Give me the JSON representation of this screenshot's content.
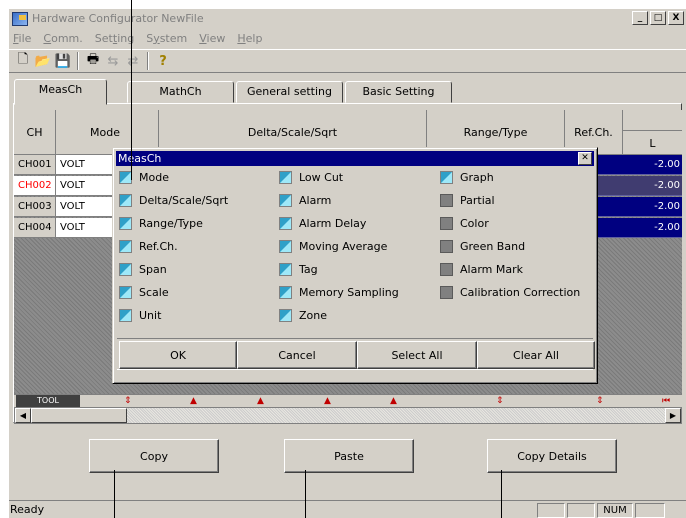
{
  "window": {
    "title": "Hardware Configurator NewFile"
  },
  "menu": [
    {
      "label": "File",
      "accel": "F",
      "rest": "ile",
      "dark": false
    },
    {
      "label": "Comm.",
      "accel": "C",
      "rest": "omm.",
      "dark": false
    },
    {
      "label": "Setting",
      "accel": "",
      "rest": "Setting",
      "dark": false
    },
    {
      "label": "System",
      "accel": "S",
      "rest": "ystem",
      "dark": false
    },
    {
      "label": "View",
      "accel": "V",
      "rest": "iew",
      "dark": false
    },
    {
      "label": "Help",
      "accel": "H",
      "rest": "elp",
      "dark": false
    }
  ],
  "tabs": [
    "MeasCh",
    "MathCh",
    "General setting",
    "Basic Setting"
  ],
  "grid": {
    "headers": [
      "CH",
      "Mode",
      "Delta/Scale/Sqrt",
      "Range/Type",
      "Ref.Ch.",
      "L"
    ],
    "rows": [
      {
        "ch": "CH001",
        "mode": "VOLT",
        "value": "-2.00",
        "red": false
      },
      {
        "ch": "CH002",
        "mode": "VOLT",
        "value": "-2.00",
        "red": true
      },
      {
        "ch": "CH003",
        "mode": "VOLT",
        "value": "-2.00",
        "red": false
      },
      {
        "ch": "CH004",
        "mode": "VOLT",
        "value": "-2.00",
        "red": false
      }
    ],
    "tool_label": "TOOL"
  },
  "dialog": {
    "title": "MeasCh",
    "close": "✕",
    "col1": [
      {
        "label": "Mode",
        "checked": true
      },
      {
        "label": "Delta/Scale/Sqrt",
        "checked": true
      },
      {
        "label": "Range/Type",
        "checked": true
      },
      {
        "label": "Ref.Ch.",
        "checked": true
      },
      {
        "label": "Span",
        "checked": true
      },
      {
        "label": "Scale",
        "checked": true
      },
      {
        "label": "Unit",
        "checked": true
      }
    ],
    "col2": [
      {
        "label": "Low Cut",
        "checked": true
      },
      {
        "label": "Alarm",
        "checked": true
      },
      {
        "label": "Alarm Delay",
        "checked": true
      },
      {
        "label": "Moving Average",
        "checked": true
      },
      {
        "label": "Tag",
        "checked": true
      },
      {
        "label": "Memory Sampling",
        "checked": true
      },
      {
        "label": "Zone",
        "checked": true
      }
    ],
    "col3": [
      {
        "label": "Graph",
        "checked": true
      },
      {
        "label": "Partial",
        "checked": false
      },
      {
        "label": "Color",
        "checked": false
      },
      {
        "label": "Green Band",
        "checked": false
      },
      {
        "label": "Alarm Mark",
        "checked": false
      },
      {
        "label": "Calibration Correction",
        "checked": false
      }
    ],
    "buttons": {
      "ok": "OK",
      "cancel": "Cancel",
      "select_all": "Select All",
      "clear_all": "Clear All"
    }
  },
  "actions": {
    "copy": "Copy",
    "paste": "Paste",
    "copy_details": "Copy Details"
  },
  "status": {
    "text": "Ready",
    "num": "NUM"
  }
}
